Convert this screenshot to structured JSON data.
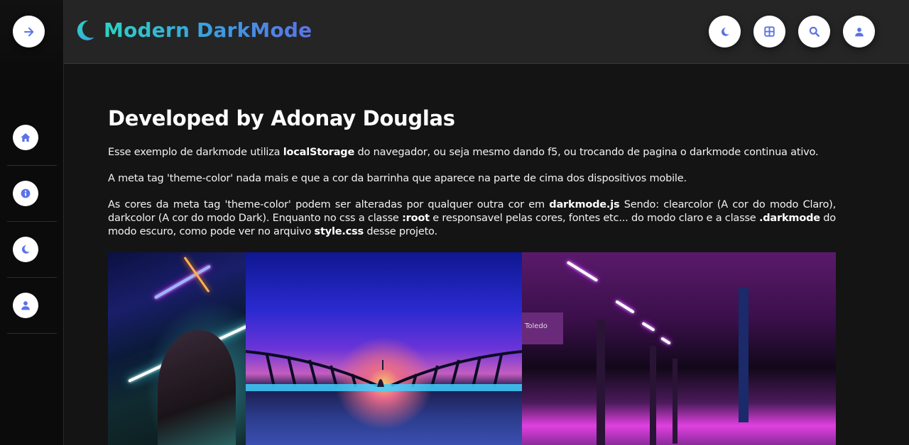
{
  "sidebar": {
    "items": [
      {
        "name": "home",
        "icon": "home-icon"
      },
      {
        "name": "info",
        "icon": "info-icon"
      },
      {
        "name": "darkmode",
        "icon": "moon-icon"
      },
      {
        "name": "user",
        "icon": "user-icon"
      }
    ]
  },
  "header": {
    "title": "Modern DarkMode",
    "actions": [
      "moon-icon",
      "grid-icon",
      "search-icon",
      "user-icon"
    ]
  },
  "main": {
    "heading": "Developed by Adonay Douglas",
    "p1": {
      "t1": "Esse exemplo de darkmode utiliza ",
      "b1": "localStorage",
      "t2": " do navegador, ou seja mesmo dando f5, ou trocando de pagina o darkmode continua ativo."
    },
    "p2": "A meta tag 'theme-color' nada mais e que a cor da barrinha que aparece na parte de cima dos dispositivos mobile.",
    "p3": {
      "t1": "As cores da meta tag 'theme-color' podem ser alteradas por qualquer outra cor em ",
      "b1": "darkmode.js",
      "t2": " Sendo: clearcolor (A cor do modo Claro), darkcolor (A cor do modo Dark). Enquanto no css a classe ",
      "b2": ":root",
      "t3": " e responsavel pelas cores, fontes etc... do modo claro e a classe ",
      "b3": ".darkmode",
      "t4": " do modo escuro, como pode ver no arquivo ",
      "b4": "style.css",
      "t5": " desse projeto."
    }
  },
  "gallery": {
    "images": [
      "neon-portrait-image",
      "bridge-sunset-image",
      "neon-station-image"
    ],
    "station_sign": "Toledo"
  },
  "colors": {
    "accent": "#5b73e6",
    "brand_gradient_start": "#2ed3c2",
    "background": "#141414",
    "header_bg": "#252525"
  }
}
